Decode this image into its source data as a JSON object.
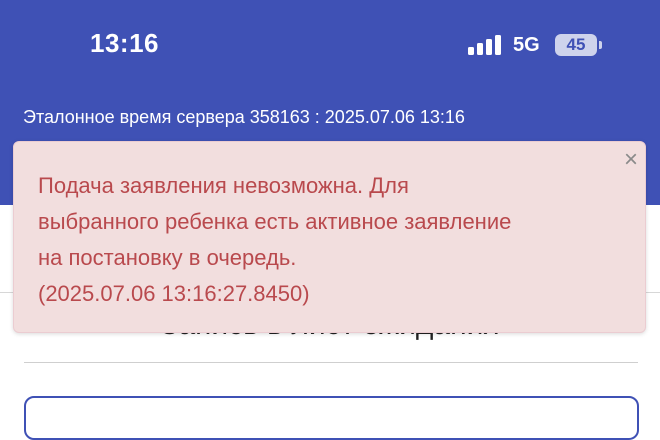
{
  "status_bar": {
    "time": "13:16",
    "network": "5G",
    "battery": "45"
  },
  "header": {
    "server_time": "Эталонное время сервера 358163 : 2025.07.06 13:16"
  },
  "page": {
    "title": "Запись в лист ожидания"
  },
  "alert": {
    "lines": [
      "Подача заявления невозможна. Для",
      "выбранного ребенка есть активное заявление",
      "на постановку в очередь.",
      "(2025.07.06 13:16:27.8450)"
    ],
    "close_symbol": "×"
  },
  "colors": {
    "header_bg": "#3f51b5",
    "alert_bg": "#f2dede",
    "alert_text": "#b9494d"
  },
  "icons": [
    "signal-icon",
    "battery-icon",
    "close-icon"
  ]
}
